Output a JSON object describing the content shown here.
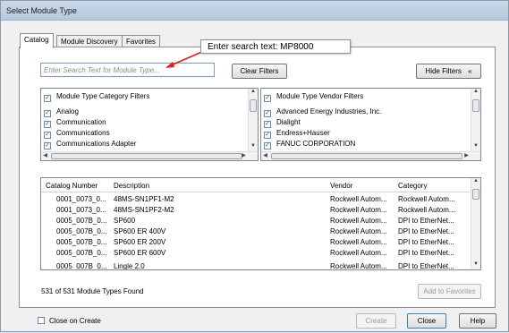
{
  "window": {
    "title": "Select Module Type"
  },
  "tabs": [
    {
      "label": "Catalog",
      "active": true
    },
    {
      "label": "Module Discovery",
      "active": false
    },
    {
      "label": "Favorites",
      "active": false
    }
  ],
  "callout": {
    "text": "Enter search text: MP8000"
  },
  "search": {
    "placeholder": "Enter Search Text for Module Type..."
  },
  "buttons": {
    "clear_filters": "Clear Filters",
    "hide_filters": "Hide Filters",
    "hide_filters_icon": "double-chevron-up-icon",
    "add_to_favorites": "Add to Favorites",
    "create": "Create",
    "close": "Close",
    "help": "Help"
  },
  "category_filters": {
    "header": "Module Type Category Filters",
    "items": [
      "Analog",
      "Communication",
      "Communications",
      "Communications Adapter"
    ]
  },
  "vendor_filters": {
    "header": "Module Type Vendor Filters",
    "items": [
      "Advanced Energy Industries, Inc.",
      "Dialight",
      "Endress+Hauser",
      "FANUC CORPORATION"
    ]
  },
  "results": {
    "columns": [
      "Catalog Number",
      "Description",
      "Vendor",
      "Category"
    ],
    "rows": [
      [
        "0001_0073_0...",
        "48MS-SN1PF1-M2",
        "Rockwell Autom...",
        "Rockwell Autom..."
      ],
      [
        "0001_0073_0...",
        "48MS-SN1PF2-M2",
        "Rockwell Autom...",
        "Rockwell Autom..."
      ],
      [
        "0005_007B_0...",
        "SP600",
        "Rockwell Autom...",
        "DPI to EtherNet..."
      ],
      [
        "0005_007B_0...",
        "SP600 ER 400V",
        "Rockwell Autom...",
        "DPI to EtherNet..."
      ],
      [
        "0005_007B_0...",
        "SP600 ER 200V",
        "Rockwell Autom...",
        "DPI to EtherNet..."
      ],
      [
        "0005_007B_0...",
        "SP600 ER 600V",
        "Rockwell Autom...",
        "DPI to EtherNet..."
      ],
      [
        "0005_007B_0...",
        "Lingle 2.0",
        "Rockwell Autom...",
        "DPI to EtherNet..."
      ]
    ]
  },
  "status": {
    "text": "531 of 531 Module Types Found"
  },
  "close_on_create": {
    "label": "Close on Create",
    "checked": false
  },
  "colors": {
    "arrow": "#e0201c",
    "titlebar": "#c0d2e6"
  }
}
